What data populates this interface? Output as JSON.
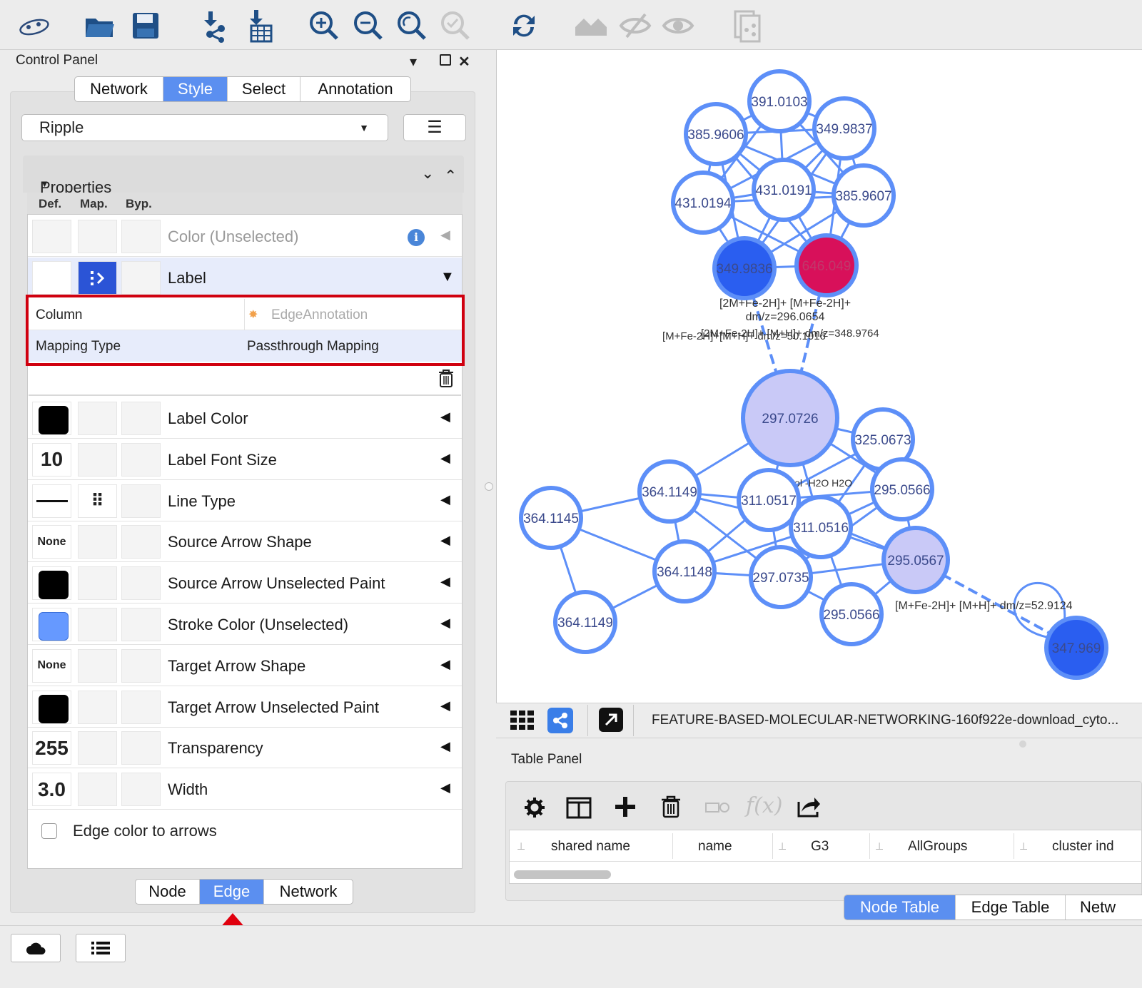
{
  "control_panel": {
    "title": "Control Panel",
    "tabs": [
      "Network",
      "Style",
      "Select",
      "Annotation"
    ],
    "active_tab": "Style",
    "style_name": "Ripple",
    "properties_header": "Properties",
    "col_headers": {
      "def": "Def.",
      "map": "Map.",
      "byp": "Byp."
    },
    "color_unselected": "Color (Unselected)",
    "label_row": "Label",
    "mapping": {
      "column_label": "Column",
      "column_value": "EdgeAnnotation",
      "type_label": "Mapping Type",
      "type_value": "Passthrough Mapping"
    },
    "rows": [
      {
        "label": "Label Color",
        "def": "",
        "swatch": "#000000"
      },
      {
        "label": "Label Font Size",
        "def": "10"
      },
      {
        "label": "Line Type",
        "def": ""
      },
      {
        "label": "Source Arrow Shape",
        "def": "None"
      },
      {
        "label": "Source Arrow Unselected Paint",
        "def": "",
        "swatch": "#000000"
      },
      {
        "label": "Stroke Color (Unselected)",
        "def": "",
        "swatch": "#6699ff"
      },
      {
        "label": "Target Arrow Shape",
        "def": "None"
      },
      {
        "label": "Target Arrow Unselected Paint",
        "def": "",
        "swatch": "#000000"
      },
      {
        "label": "Transparency",
        "def": "255"
      },
      {
        "label": "Width",
        "def": "3.0"
      }
    ],
    "edge_color_to_arrows": "Edge color to arrows",
    "bottom_tabs": [
      "Node",
      "Edge",
      "Network"
    ],
    "active_bottom_tab": "Edge"
  },
  "network": {
    "nodes": [
      {
        "label": "391.0103"
      },
      {
        "label": "385.9606"
      },
      {
        "label": "349.9837"
      },
      {
        "label": "431.0191"
      },
      {
        "label": "431.0194"
      },
      {
        "label": "385.9607"
      },
      {
        "label": "349.9836"
      },
      {
        "label": "646.049"
      },
      {
        "label": "297.0726"
      },
      {
        "label": "325.0673"
      },
      {
        "label": "364.1149"
      },
      {
        "label": "311.0517"
      },
      {
        "label": "295.0566"
      },
      {
        "label": "364.1145"
      },
      {
        "label": "311.0516"
      },
      {
        "label": "295.0567"
      },
      {
        "label": "364.1148"
      },
      {
        "label": "297.0735"
      },
      {
        "label": "295.0566"
      },
      {
        "label": "364.1149"
      },
      {
        "label": "347.969"
      }
    ],
    "edge_labels": [
      "[2M+Fe-2H]+ [M+Fe-2H]+",
      "dm/z=296.0654",
      "[M+Fe-2H]+[M+H]+ dm/z=50.1016",
      "[2M+Fe-2H]+ [M+H]+ dm/z=348.9764",
      "[M+Fe-2H]+ [M+H]+ dm/z=52.9124",
      "ethanol -H2O H2O"
    ],
    "file_name": "FEATURE-BASED-MOLECULAR-NETWORKING-160f922e-download_cyto..."
  },
  "table_panel": {
    "title": "Table Panel",
    "columns": [
      "shared name",
      "name",
      "G3",
      "AllGroups",
      "cluster ind"
    ],
    "tabs": [
      "Node Table",
      "Edge Table",
      "Netw"
    ],
    "active_tab": "Node Table"
  },
  "colors": {
    "accent": "#5b8ff0",
    "node_stroke": "#5d8ff8",
    "highlight_red": "#d0000f",
    "node_dark": "#2a5ef0",
    "node_pink": "#d8105a",
    "node_lavender": "#c9c9f7"
  }
}
